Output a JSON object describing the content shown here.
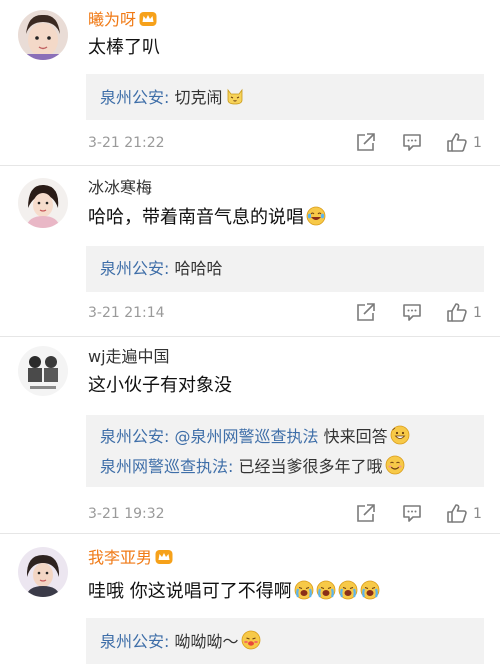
{
  "comments": [
    {
      "name": "曦为呀",
      "text": "太棒了叭",
      "replies": [
        {
          "author": "泉州公安",
          "sep": ": ",
          "text": "切克闹"
        }
      ],
      "time": "3-21 21:22",
      "likes": "1"
    },
    {
      "name": "冰冰寒梅",
      "text": "哈哈，带着南音气息的说唱",
      "replies": [
        {
          "author": "泉州公安",
          "sep": ": ",
          "text": "哈哈哈"
        }
      ],
      "time": "3-21 21:14",
      "likes": "1"
    },
    {
      "name": "wj走遍中国",
      "text": "这小伙子有对象没",
      "replies": [
        {
          "author": "泉州公安",
          "sep": ": ",
          "mention": "@泉州网警巡查执法",
          "text": " 快来回答"
        },
        {
          "author": "泉州网警巡查执法",
          "sep": ": ",
          "text": "已经当爹很多年了哦"
        }
      ],
      "time": "3-21 19:32",
      "likes": "1"
    },
    {
      "name": "我李亚男",
      "text": "哇哦   你这说唱可了不得啊",
      "replies": [
        {
          "author": "泉州公安",
          "sep": ": ",
          "text": "呦呦呦～"
        }
      ]
    }
  ],
  "icons": {
    "share": "share-icon",
    "comment": "comment-icon",
    "like": "thumbs-up-icon",
    "vip": "vip-crown-icon"
  },
  "colors": {
    "vip_name": "#f07a16",
    "link": "#3e6ea8",
    "reply_bg": "#f2f2f2",
    "meta": "#9a9a9a"
  }
}
